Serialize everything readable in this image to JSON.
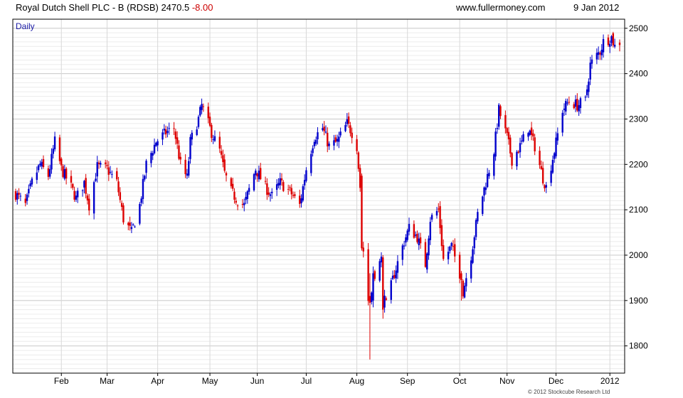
{
  "header": {
    "title": "Royal Dutch Shell PLC - B (RDSB) 2470.5",
    "change": "-8.00",
    "site": "www.fullermoney.com",
    "date": "9 Jan 2012"
  },
  "footer": {
    "copyright": "© 2012 Stockcube Research Ltd"
  },
  "chart_data": {
    "type": "candlestick",
    "period_label": "Daily",
    "y_axis_side": "right",
    "ylim": [
      1740,
      2520
    ],
    "y_ticks": [
      1800,
      1900,
      2000,
      2100,
      2200,
      2300,
      2400,
      2500
    ],
    "y_tick_labels": [
      "1800",
      "1900",
      "2000",
      "2100",
      "2200",
      "2300",
      "2400",
      "2500"
    ],
    "grid": true,
    "x_range": [
      "2011-01-04",
      "2012-01-09"
    ],
    "x_ticks": [
      {
        "label": "Feb",
        "date": "2011-02-01"
      },
      {
        "label": "Mar",
        "date": "2011-03-01"
      },
      {
        "label": "Apr",
        "date": "2011-04-01"
      },
      {
        "label": "May",
        "date": "2011-05-03"
      },
      {
        "label": "Jun",
        "date": "2011-06-01"
      },
      {
        "label": "Jul",
        "date": "2011-07-01"
      },
      {
        "label": "Aug",
        "date": "2011-08-01"
      },
      {
        "label": "Sep",
        "date": "2011-09-01"
      },
      {
        "label": "Oct",
        "date": "2011-10-03"
      },
      {
        "label": "Nov",
        "date": "2011-11-01"
      },
      {
        "label": "Dec",
        "date": "2011-12-01"
      },
      {
        "label": "2012",
        "date": "2012-01-03"
      }
    ],
    "colors": {
      "up": "#0000cc",
      "down": "#dd0000"
    },
    "close_path": [
      [
        "2011-01-04",
        2135
      ],
      [
        "2011-01-10",
        2110
      ],
      [
        "2011-01-14",
        2160
      ],
      [
        "2011-01-19",
        2200
      ],
      [
        "2011-01-24",
        2175
      ],
      [
        "2011-01-28",
        2250
      ],
      [
        "2011-02-01",
        2190
      ],
      [
        "2011-02-07",
        2150
      ],
      [
        "2011-02-10",
        2125
      ],
      [
        "2011-02-15",
        2160
      ],
      [
        "2011-02-18",
        2110
      ],
      [
        "2011-02-23",
        2195
      ],
      [
        "2011-03-01",
        2190
      ],
      [
        "2011-03-07",
        2160
      ],
      [
        "2011-03-11",
        2080
      ],
      [
        "2011-03-16",
        2050
      ],
      [
        "2011-03-21",
        2110
      ],
      [
        "2011-03-25",
        2200
      ],
      [
        "2011-03-31",
        2250
      ],
      [
        "2011-04-06",
        2270
      ],
      [
        "2011-04-11",
        2280
      ],
      [
        "2011-04-15",
        2200
      ],
      [
        "2011-04-19",
        2170
      ],
      [
        "2011-04-21",
        2250
      ],
      [
        "2011-04-26",
        2300
      ],
      [
        "2011-04-28",
        2330
      ],
      [
        "2011-05-04",
        2270
      ],
      [
        "2011-05-09",
        2230
      ],
      [
        "2011-05-12",
        2180
      ],
      [
        "2011-05-16",
        2140
      ],
      [
        "2011-05-20",
        2120
      ],
      [
        "2011-05-24",
        2110
      ],
      [
        "2011-05-31",
        2190
      ],
      [
        "2011-06-06",
        2150
      ],
      [
        "2011-06-10",
        2130
      ],
      [
        "2011-06-15",
        2160
      ],
      [
        "2011-06-21",
        2140
      ],
      [
        "2011-06-27",
        2110
      ],
      [
        "2011-07-01",
        2190
      ],
      [
        "2011-07-06",
        2260
      ],
      [
        "2011-07-11",
        2280
      ],
      [
        "2011-07-15",
        2240
      ],
      [
        "2011-07-20",
        2250
      ],
      [
        "2011-07-26",
        2290
      ],
      [
        "2011-07-29",
        2270
      ],
      [
        "2011-08-01",
        2240
      ],
      [
        "2011-08-03",
        2150
      ],
      [
        "2011-08-05",
        2010
      ],
      [
        "2011-08-08",
        1900
      ],
      [
        "2011-08-10",
        1920
      ],
      [
        "2011-08-12",
        1960
      ],
      [
        "2011-08-16",
        1990
      ],
      [
        "2011-08-19",
        1890
      ],
      [
        "2011-08-24",
        1960
      ],
      [
        "2011-08-30",
        2030
      ],
      [
        "2011-09-02",
        2060
      ],
      [
        "2011-09-07",
        2040
      ],
      [
        "2011-09-12",
        1980
      ],
      [
        "2011-09-15",
        2080
      ],
      [
        "2011-09-20",
        2100
      ],
      [
        "2011-09-23",
        1990
      ],
      [
        "2011-09-28",
        2020
      ],
      [
        "2011-10-03",
        1960
      ],
      [
        "2011-10-05",
        1920
      ],
      [
        "2011-10-10",
        2000
      ],
      [
        "2011-10-14",
        2090
      ],
      [
        "2011-10-19",
        2160
      ],
      [
        "2011-10-24",
        2230
      ],
      [
        "2011-10-27",
        2320
      ],
      [
        "2011-11-01",
        2260
      ],
      [
        "2011-11-04",
        2210
      ],
      [
        "2011-11-09",
        2240
      ],
      [
        "2011-11-14",
        2280
      ],
      [
        "2011-11-18",
        2240
      ],
      [
        "2011-11-23",
        2170
      ],
      [
        "2011-11-25",
        2150
      ],
      [
        "2011-11-30",
        2230
      ],
      [
        "2011-12-05",
        2320
      ],
      [
        "2011-12-09",
        2340
      ],
      [
        "2011-12-14",
        2330
      ],
      [
        "2011-12-19",
        2340
      ],
      [
        "2011-12-22",
        2420
      ],
      [
        "2011-12-28",
        2450
      ],
      [
        "2011-12-30",
        2470
      ],
      [
        "2012-01-04",
        2480
      ],
      [
        "2012-01-06",
        2460
      ],
      [
        "2012-01-09",
        2470
      ]
    ],
    "special_candles": [
      {
        "date": "2011-08-04",
        "open": 2175,
        "high": 2180,
        "low": 2010,
        "close": 2015
      },
      {
        "date": "2011-08-09",
        "open": 1910,
        "high": 1960,
        "low": 1770,
        "close": 1895
      },
      {
        "date": "2011-08-11",
        "open": 1900,
        "high": 1975,
        "low": 1885,
        "close": 1960
      },
      {
        "date": "2011-08-17",
        "open": 1995,
        "high": 2000,
        "low": 1860,
        "close": 1880
      },
      {
        "date": "2011-10-04",
        "open": 1960,
        "high": 1965,
        "low": 1900,
        "close": 1945
      }
    ]
  }
}
